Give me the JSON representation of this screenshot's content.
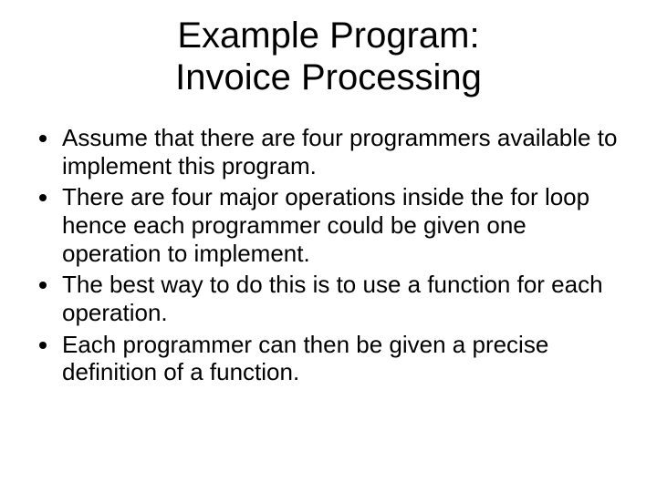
{
  "title_line1": "Example Program:",
  "title_line2": "Invoice Processing",
  "bullets": [
    "Assume that there are four programmers available to implement this program.",
    "There are four major operations inside the for loop hence each programmer could be given one operation to implement.",
    "The best way to do this is to use a function for each operation.",
    "Each programmer can then be given a precise definition of a function."
  ]
}
